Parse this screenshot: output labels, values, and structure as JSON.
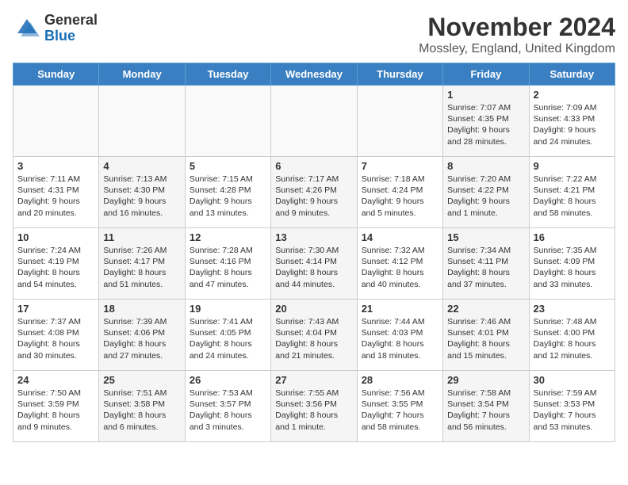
{
  "header": {
    "logo_general": "General",
    "logo_blue": "Blue",
    "month_title": "November 2024",
    "location": "Mossley, England, United Kingdom"
  },
  "weekdays": [
    "Sunday",
    "Monday",
    "Tuesday",
    "Wednesday",
    "Thursday",
    "Friday",
    "Saturday"
  ],
  "weeks": [
    {
      "days": [
        {
          "num": "",
          "info": ""
        },
        {
          "num": "",
          "info": ""
        },
        {
          "num": "",
          "info": ""
        },
        {
          "num": "",
          "info": ""
        },
        {
          "num": "",
          "info": ""
        },
        {
          "num": "1",
          "info": "Sunrise: 7:07 AM\nSunset: 4:35 PM\nDaylight: 9 hours\nand 28 minutes."
        },
        {
          "num": "2",
          "info": "Sunrise: 7:09 AM\nSunset: 4:33 PM\nDaylight: 9 hours\nand 24 minutes."
        }
      ]
    },
    {
      "days": [
        {
          "num": "3",
          "info": "Sunrise: 7:11 AM\nSunset: 4:31 PM\nDaylight: 9 hours\nand 20 minutes."
        },
        {
          "num": "4",
          "info": "Sunrise: 7:13 AM\nSunset: 4:30 PM\nDaylight: 9 hours\nand 16 minutes."
        },
        {
          "num": "5",
          "info": "Sunrise: 7:15 AM\nSunset: 4:28 PM\nDaylight: 9 hours\nand 13 minutes."
        },
        {
          "num": "6",
          "info": "Sunrise: 7:17 AM\nSunset: 4:26 PM\nDaylight: 9 hours\nand 9 minutes."
        },
        {
          "num": "7",
          "info": "Sunrise: 7:18 AM\nSunset: 4:24 PM\nDaylight: 9 hours\nand 5 minutes."
        },
        {
          "num": "8",
          "info": "Sunrise: 7:20 AM\nSunset: 4:22 PM\nDaylight: 9 hours\nand 1 minute."
        },
        {
          "num": "9",
          "info": "Sunrise: 7:22 AM\nSunset: 4:21 PM\nDaylight: 8 hours\nand 58 minutes."
        }
      ]
    },
    {
      "days": [
        {
          "num": "10",
          "info": "Sunrise: 7:24 AM\nSunset: 4:19 PM\nDaylight: 8 hours\nand 54 minutes."
        },
        {
          "num": "11",
          "info": "Sunrise: 7:26 AM\nSunset: 4:17 PM\nDaylight: 8 hours\nand 51 minutes."
        },
        {
          "num": "12",
          "info": "Sunrise: 7:28 AM\nSunset: 4:16 PM\nDaylight: 8 hours\nand 47 minutes."
        },
        {
          "num": "13",
          "info": "Sunrise: 7:30 AM\nSunset: 4:14 PM\nDaylight: 8 hours\nand 44 minutes."
        },
        {
          "num": "14",
          "info": "Sunrise: 7:32 AM\nSunset: 4:12 PM\nDaylight: 8 hours\nand 40 minutes."
        },
        {
          "num": "15",
          "info": "Sunrise: 7:34 AM\nSunset: 4:11 PM\nDaylight: 8 hours\nand 37 minutes."
        },
        {
          "num": "16",
          "info": "Sunrise: 7:35 AM\nSunset: 4:09 PM\nDaylight: 8 hours\nand 33 minutes."
        }
      ]
    },
    {
      "days": [
        {
          "num": "17",
          "info": "Sunrise: 7:37 AM\nSunset: 4:08 PM\nDaylight: 8 hours\nand 30 minutes."
        },
        {
          "num": "18",
          "info": "Sunrise: 7:39 AM\nSunset: 4:06 PM\nDaylight: 8 hours\nand 27 minutes."
        },
        {
          "num": "19",
          "info": "Sunrise: 7:41 AM\nSunset: 4:05 PM\nDaylight: 8 hours\nand 24 minutes."
        },
        {
          "num": "20",
          "info": "Sunrise: 7:43 AM\nSunset: 4:04 PM\nDaylight: 8 hours\nand 21 minutes."
        },
        {
          "num": "21",
          "info": "Sunrise: 7:44 AM\nSunset: 4:03 PM\nDaylight: 8 hours\nand 18 minutes."
        },
        {
          "num": "22",
          "info": "Sunrise: 7:46 AM\nSunset: 4:01 PM\nDaylight: 8 hours\nand 15 minutes."
        },
        {
          "num": "23",
          "info": "Sunrise: 7:48 AM\nSunset: 4:00 PM\nDaylight: 8 hours\nand 12 minutes."
        }
      ]
    },
    {
      "days": [
        {
          "num": "24",
          "info": "Sunrise: 7:50 AM\nSunset: 3:59 PM\nDaylight: 8 hours\nand 9 minutes."
        },
        {
          "num": "25",
          "info": "Sunrise: 7:51 AM\nSunset: 3:58 PM\nDaylight: 8 hours\nand 6 minutes."
        },
        {
          "num": "26",
          "info": "Sunrise: 7:53 AM\nSunset: 3:57 PM\nDaylight: 8 hours\nand 3 minutes."
        },
        {
          "num": "27",
          "info": "Sunrise: 7:55 AM\nSunset: 3:56 PM\nDaylight: 8 hours\nand 1 minute."
        },
        {
          "num": "28",
          "info": "Sunrise: 7:56 AM\nSunset: 3:55 PM\nDaylight: 7 hours\nand 58 minutes."
        },
        {
          "num": "29",
          "info": "Sunrise: 7:58 AM\nSunset: 3:54 PM\nDaylight: 7 hours\nand 56 minutes."
        },
        {
          "num": "30",
          "info": "Sunrise: 7:59 AM\nSunset: 3:53 PM\nDaylight: 7 hours\nand 53 minutes."
        }
      ]
    }
  ]
}
